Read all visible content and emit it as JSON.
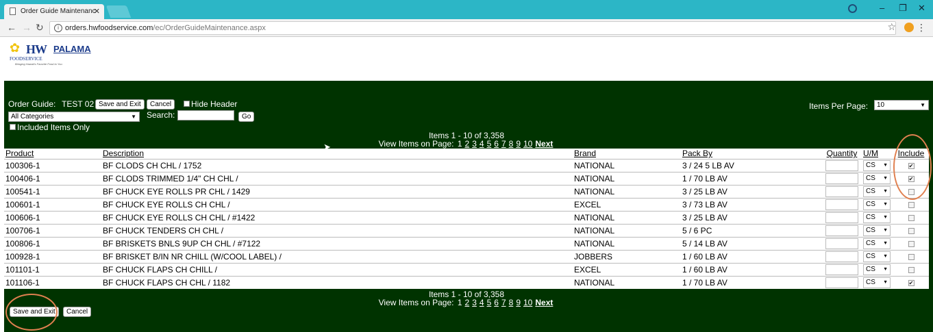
{
  "browser": {
    "tab_title": "Order Guide Maintenanc",
    "url_host": "orders.hwfoodservice.com",
    "url_path": "/ec/OrderGuideMaintenance.aspx"
  },
  "logo": {
    "main": "HW",
    "palama": "PALAMA",
    "sub": "FOODSERVICE",
    "tagline": "Bringing Hawaii's Favorite Food to You"
  },
  "toolbar": {
    "order_guide_label": "Order Guide:",
    "order_guide_name": "TEST 02",
    "save_exit_label": "Save and Exit",
    "cancel_label": "Cancel",
    "hide_header_label": "Hide Header",
    "category_value": "All Categories",
    "search_label": "Search:",
    "go_label": "Go",
    "included_only_label": "Included Items Only",
    "items_per_page_label": "Items Per Page:",
    "items_per_page_value": "10"
  },
  "pager": {
    "summary": "Items 1 - 10 of 3,358",
    "view_label": "View Items on Page:",
    "current": "1",
    "pages": [
      "2",
      "3",
      "4",
      "5",
      "6",
      "7",
      "8",
      "9",
      "10"
    ],
    "next": "Next"
  },
  "table": {
    "headers": {
      "product": "Product",
      "description": "Description",
      "brand": "Brand",
      "pack_by": "Pack By",
      "quantity": "Quantity",
      "um": "U/M",
      "include": "Include"
    },
    "rows": [
      {
        "product": "100306-1",
        "description": "BF CLODS CH CHL / 1752",
        "brand": "NATIONAL",
        "pack": "3 / 24 5 LB AV",
        "um": "CS",
        "included": true
      },
      {
        "product": "100406-1",
        "description": "BF CLODS TRIMMED 1/4\" CH CHL /",
        "brand": "NATIONAL",
        "pack": "1 / 70 LB AV",
        "um": "CS",
        "included": true
      },
      {
        "product": "100541-1",
        "description": "BF CHUCK EYE ROLLS PR CHL / 1429",
        "brand": "NATIONAL",
        "pack": "3 / 25 LB AV",
        "um": "CS",
        "included": false
      },
      {
        "product": "100601-1",
        "description": "BF CHUCK EYE ROLLS CH CHL /",
        "brand": "EXCEL",
        "pack": "3 / 73 LB AV",
        "um": "CS",
        "included": false
      },
      {
        "product": "100606-1",
        "description": "BF CHUCK EYE ROLLS CH CHL / #1422",
        "brand": "NATIONAL",
        "pack": "3 / 25 LB AV",
        "um": "CS",
        "included": false
      },
      {
        "product": "100706-1",
        "description": "BF CHUCK TENDERS CH CHL /",
        "brand": "NATIONAL",
        "pack": "5 / 6 PC",
        "um": "CS",
        "included": false
      },
      {
        "product": "100806-1",
        "description": "BF BRISKETS BNLS 9UP CH CHL / #7122",
        "brand": "NATIONAL",
        "pack": "5 / 14 LB AV",
        "um": "CS",
        "included": false
      },
      {
        "product": "100928-1",
        "description": "BF BRISKET B/IN NR CHILL (W/COOL LABEL) /",
        "brand": "JOBBERS",
        "pack": "1 / 60 LB AV",
        "um": "CS",
        "included": false
      },
      {
        "product": "101101-1",
        "description": "BF CHUCK FLAPS CH CHILL /",
        "brand": "EXCEL",
        "pack": "1 / 60 LB AV",
        "um": "CS",
        "included": false
      },
      {
        "product": "101106-1",
        "description": "BF CHUCK FLAPS CH CHL / 1182",
        "brand": "NATIONAL",
        "pack": "1 / 70 LB AV",
        "um": "CS",
        "included": true
      }
    ]
  },
  "colors": {
    "panel_bg": "#003300",
    "titlebar": "#2cb6c6",
    "highlight": "#e08050"
  }
}
